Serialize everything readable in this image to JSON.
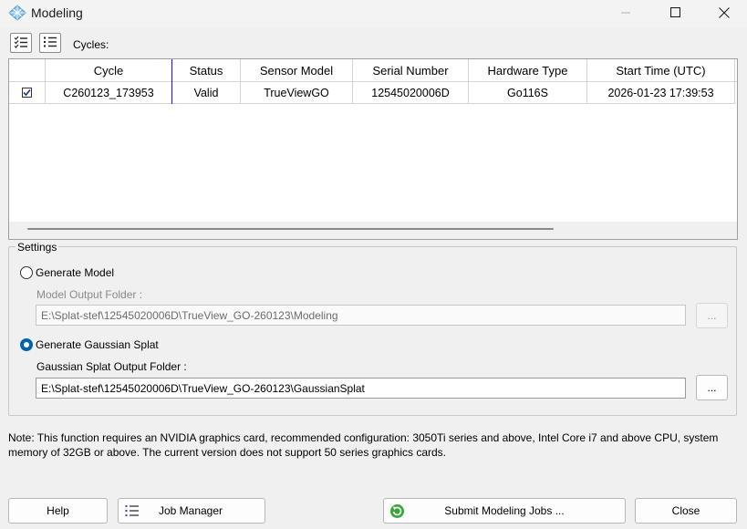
{
  "window": {
    "title": "Modeling",
    "app_icon": "diamond-grid-icon",
    "controls": [
      "minimize-icon",
      "maximize-icon",
      "close-icon"
    ]
  },
  "toolbar": {
    "select_all_icon": "check-list-icon",
    "deselect_all_icon": "list-icon",
    "cycles_label": "Cycles:"
  },
  "table": {
    "columns": [
      "",
      "Cycle",
      "Status",
      "Sensor Model",
      "Serial Number",
      "Hardware Type",
      "Start Time (UTC)"
    ],
    "rows": [
      {
        "checked": true,
        "cycle": "C260123_173953",
        "status": "Valid",
        "sensor_model": "TrueViewGO",
        "serial_number": "12545020006D",
        "hardware_type": "Go116S",
        "start_time": "2026-01-23 17:39:53"
      }
    ]
  },
  "settings": {
    "legend": "Settings",
    "generate_model": {
      "label": "Generate Model",
      "selected": false,
      "folder_label": "Model Output Folder :",
      "folder_value": "E:\\Splat-stef\\12545020006D\\TrueView_GO-260123\\Modeling",
      "browse_label": "..."
    },
    "generate_splat": {
      "label": "Generate Gaussian Splat",
      "selected": true,
      "folder_label": "Gaussian Splat Output Folder :",
      "folder_value": "E:\\Splat-stef\\12545020006D\\TrueView_GO-260123\\GaussianSplat",
      "browse_label": "..."
    }
  },
  "note": "Note: This function requires an NVIDIA graphics card, recommended configuration: 3050Ti series and above, Intel Core i7 and above CPU, system memory of 32GB or above. The current version does not support 50 series graphics cards.",
  "buttons": {
    "help": "Help",
    "job_manager": "Job Manager",
    "submit": "Submit Modeling Jobs ...",
    "close": "Close"
  },
  "colors": {
    "accent": "#0063b1",
    "sort_indicator": "#1e1e9a",
    "submit_icon": "#3aa53a"
  }
}
